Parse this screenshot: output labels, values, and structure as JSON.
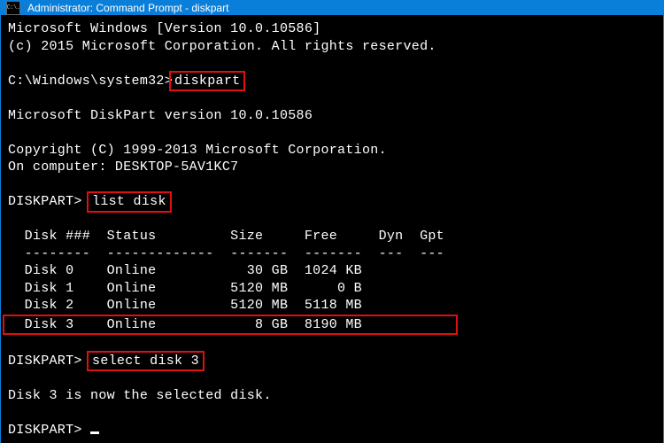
{
  "titlebar": {
    "icon_text": "C:\\.",
    "title": "Administrator: Command Prompt - diskpart"
  },
  "lines": {
    "version_line": "Microsoft Windows [Version 10.0.10586]",
    "copyright1": "(c) 2015 Microsoft Corporation. All rights reserved.",
    "prompt1": "C:\\Windows\\system32>",
    "cmd1": "diskpart",
    "dp_version": "Microsoft DiskPart version 10.0.10586",
    "dp_copyright": "Copyright (C) 1999-2013 Microsoft Corporation.",
    "dp_on_computer": "On computer: DESKTOP-5AV1KC7",
    "dp_prompt": "DISKPART>",
    "cmd2": "list disk",
    "table_header": "  Disk ###  Status         Size     Free     Dyn  Gpt",
    "table_divider": "  --------  -------------  -------  -------  ---  ---",
    "row0": "  Disk 0    Online           30 GB  1024 KB",
    "row1": "  Disk 1    Online         5120 MB      0 B",
    "row2": "  Disk 2    Online         5120 MB  5118 MB",
    "row3": "  Disk 3    Online            8 GB  8190 MB           ",
    "cmd3": "select disk 3",
    "result": "Disk 3 is now the selected disk."
  },
  "chart_data": {
    "type": "table",
    "title": "diskpart list disk",
    "columns": [
      "Disk ###",
      "Status",
      "Size",
      "Free",
      "Dyn",
      "Gpt"
    ],
    "rows": [
      {
        "disk": "Disk 0",
        "status": "Online",
        "size": "30 GB",
        "free": "1024 KB",
        "dyn": "",
        "gpt": ""
      },
      {
        "disk": "Disk 1",
        "status": "Online",
        "size": "5120 MB",
        "free": "0 B",
        "dyn": "",
        "gpt": ""
      },
      {
        "disk": "Disk 2",
        "status": "Online",
        "size": "5120 MB",
        "free": "5118 MB",
        "dyn": "",
        "gpt": ""
      },
      {
        "disk": "Disk 3",
        "status": "Online",
        "size": "8 GB",
        "free": "8190 MB",
        "dyn": "",
        "gpt": ""
      }
    ]
  },
  "highlights": [
    "diskpart",
    "list disk",
    "Disk 3 row",
    "select disk 3"
  ]
}
